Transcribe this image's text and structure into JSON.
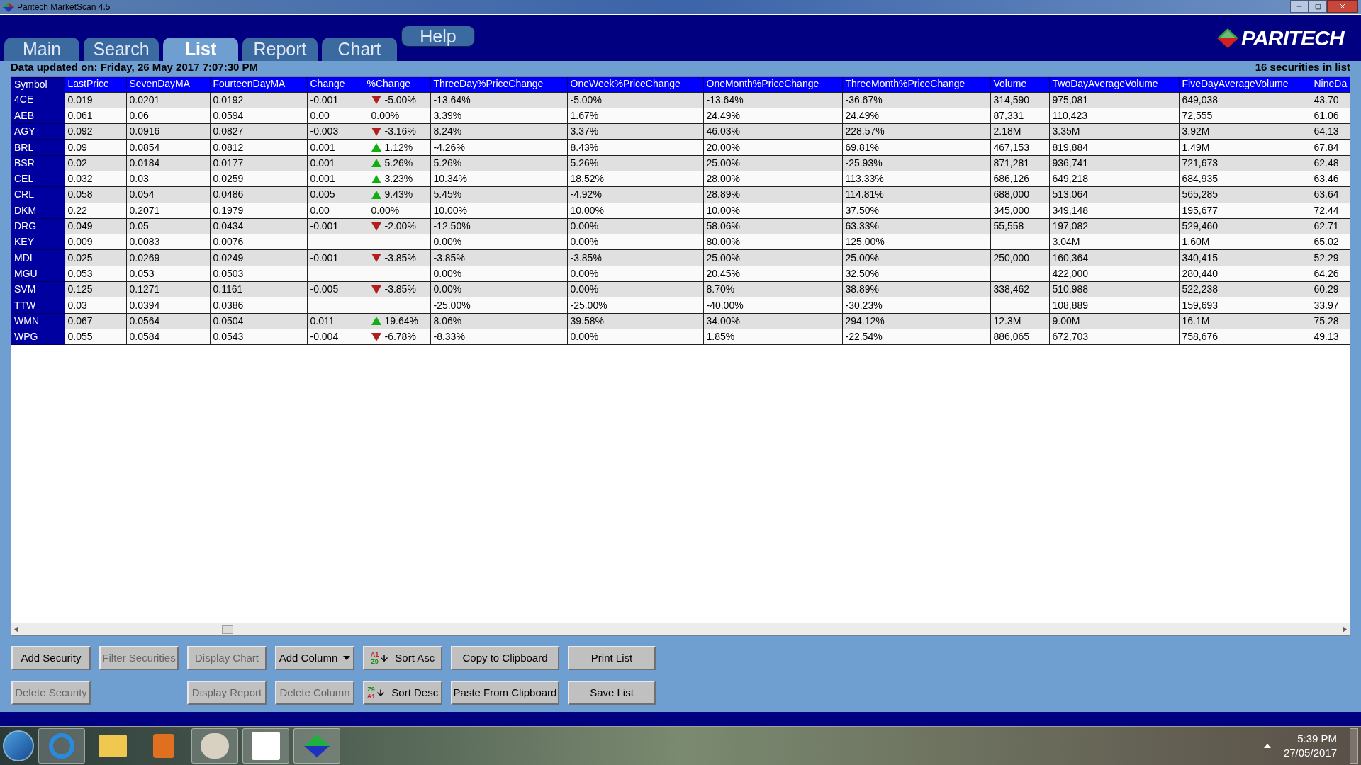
{
  "window": {
    "title": "Paritech MarketScan 4.5"
  },
  "tabs": [
    {
      "label": "Main",
      "kind": "tab",
      "selected": false
    },
    {
      "label": "Search",
      "kind": "tab",
      "selected": false
    },
    {
      "label": "List",
      "kind": "tab",
      "selected": true
    },
    {
      "label": "Report",
      "kind": "tab",
      "selected": false
    },
    {
      "label": "Chart",
      "kind": "tab",
      "selected": false
    },
    {
      "label": "Help",
      "kind": "button",
      "selected": false
    }
  ],
  "logo": {
    "text": "PARITECH"
  },
  "status": {
    "updated": "Data updated on: Friday, 26 May 2017 7:07:30 PM",
    "count": "16 securities in list"
  },
  "table": {
    "columns": [
      "Symbol",
      "LastPrice",
      "SevenDayMA",
      "FourteenDayMA",
      "Change",
      "%Change",
      "ThreeDay%PriceChange",
      "OneWeek%PriceChange",
      "OneMonth%PriceChange",
      "ThreeMonth%PriceChange",
      "Volume",
      "TwoDayAverageVolume",
      "FiveDayAverageVolume",
      "NineDa"
    ],
    "rows": [
      {
        "kind": "down",
        "cells": [
          "4CE",
          "0.019",
          "0.0201",
          "0.0192",
          "-0.001",
          "-5.00%",
          "-13.64%",
          "-5.00%",
          "-13.64%",
          "-36.67%",
          "314,590",
          "975,081",
          "649,038",
          "43.70"
        ]
      },
      {
        "kind": "none",
        "cells": [
          "AEB",
          "0.061",
          "0.06",
          "0.0594",
          "0.00",
          "0.00%",
          "3.39%",
          "1.67%",
          "24.49%",
          "24.49%",
          "87,331",
          "110,423",
          "72,555",
          "61.06"
        ]
      },
      {
        "kind": "down",
        "cells": [
          "AGY",
          "0.092",
          "0.0916",
          "0.0827",
          "-0.003",
          "-3.16%",
          "8.24%",
          "3.37%",
          "46.03%",
          "228.57%",
          "2.18M",
          "3.35M",
          "3.92M",
          "64.13"
        ]
      },
      {
        "kind": "up",
        "cells": [
          "BRL",
          "0.09",
          "0.0854",
          "0.0812",
          "0.001",
          "1.12%",
          "-4.26%",
          "8.43%",
          "20.00%",
          "69.81%",
          "467,153",
          "819,884",
          "1.49M",
          "67.84"
        ]
      },
      {
        "kind": "up",
        "cells": [
          "BSR",
          "0.02",
          "0.0184",
          "0.0177",
          "0.001",
          "5.26%",
          "5.26%",
          "5.26%",
          "25.00%",
          "-25.93%",
          "871,281",
          "936,741",
          "721,673",
          "62.48"
        ]
      },
      {
        "kind": "up",
        "cells": [
          "CEL",
          "0.032",
          "0.03",
          "0.0259",
          "0.001",
          "3.23%",
          "10.34%",
          "18.52%",
          "28.00%",
          "113.33%",
          "686,126",
          "649,218",
          "684,935",
          "63.46"
        ]
      },
      {
        "kind": "up",
        "cells": [
          "CRL",
          "0.058",
          "0.054",
          "0.0486",
          "0.005",
          "9.43%",
          "5.45%",
          "-4.92%",
          "28.89%",
          "114.81%",
          "688,000",
          "513,064",
          "565,285",
          "63.64"
        ]
      },
      {
        "kind": "none",
        "cells": [
          "DKM",
          "0.22",
          "0.2071",
          "0.1979",
          "0.00",
          "0.00%",
          "10.00%",
          "10.00%",
          "10.00%",
          "37.50%",
          "345,000",
          "349,148",
          "195,677",
          "72.44"
        ]
      },
      {
        "kind": "down",
        "cells": [
          "DRG",
          "0.049",
          "0.05",
          "0.0434",
          "-0.001",
          "-2.00%",
          "-12.50%",
          "0.00%",
          "58.06%",
          "63.33%",
          "55,558",
          "197,082",
          "529,460",
          "62.71"
        ]
      },
      {
        "kind": "none",
        "cells": [
          "KEY",
          "0.009",
          "0.0083",
          "0.0076",
          null,
          null,
          "0.00%",
          "0.00%",
          "80.00%",
          "125.00%",
          null,
          "3.04M",
          "1.60M",
          "65.02"
        ]
      },
      {
        "kind": "down",
        "cells": [
          "MDI",
          "0.025",
          "0.0269",
          "0.0249",
          "-0.001",
          "-3.85%",
          "-3.85%",
          "-3.85%",
          "25.00%",
          "25.00%",
          "250,000",
          "160,364",
          "340,415",
          "52.29"
        ]
      },
      {
        "kind": "none",
        "cells": [
          "MGU",
          "0.053",
          "0.053",
          "0.0503",
          null,
          null,
          "0.00%",
          "0.00%",
          "20.45%",
          "32.50%",
          null,
          "422,000",
          "280,440",
          "64.26"
        ]
      },
      {
        "kind": "down",
        "cells": [
          "SVM",
          "0.125",
          "0.1271",
          "0.1161",
          "-0.005",
          "-3.85%",
          "0.00%",
          "0.00%",
          "8.70%",
          "38.89%",
          "338,462",
          "510,988",
          "522,238",
          "60.29"
        ]
      },
      {
        "kind": "none",
        "cells": [
          "TTW",
          "0.03",
          "0.0394",
          "0.0386",
          null,
          null,
          "-25.00%",
          "-25.00%",
          "-40.00%",
          "-30.23%",
          null,
          "108,889",
          "159,693",
          "33.97"
        ]
      },
      {
        "kind": "up",
        "cells": [
          "WMN",
          "0.067",
          "0.0564",
          "0.0504",
          "0.011",
          "19.64%",
          "8.06%",
          "39.58%",
          "34.00%",
          "294.12%",
          "12.3M",
          "9.00M",
          "16.1M",
          "75.28"
        ]
      },
      {
        "kind": "down",
        "cells": [
          "WPG",
          "0.055",
          "0.0584",
          "0.0543",
          "-0.004",
          "-6.78%",
          "-8.33%",
          "0.00%",
          "1.85%",
          "-22.54%",
          "886,065",
          "672,703",
          "758,676",
          "49.13"
        ]
      }
    ]
  },
  "buttons": [
    [
      {
        "label": "Add Security",
        "kind": "plain",
        "disabled": false
      },
      {
        "label": "Filter Securities",
        "kind": "plain",
        "disabled": true
      },
      {
        "label": "Display Chart",
        "kind": "plain",
        "disabled": true
      },
      {
        "label": "Add Column",
        "kind": "dropdown",
        "disabled": false
      },
      {
        "label": "Sort Asc",
        "kind": "sort_asc",
        "icon_top": "A1",
        "icon_bottom": "Z9",
        "disabled": false
      },
      {
        "label": "Copy to Clipboard",
        "kind": "plain",
        "disabled": false
      },
      {
        "label": "Print List",
        "kind": "plain",
        "disabled": false
      }
    ],
    [
      {
        "label": "Delete Security",
        "kind": "plain",
        "disabled": true
      },
      {
        "label": "Display Report",
        "kind": "plain",
        "disabled": true
      },
      {
        "label": "Delete Column",
        "kind": "plain",
        "disabled": true
      },
      {
        "label": "Sort Desc",
        "kind": "sort_desc",
        "icon_top": "Z9",
        "icon_bottom": "A1",
        "disabled": false
      },
      {
        "label": "Paste From Clipboard",
        "kind": "plain",
        "disabled": false
      },
      {
        "label": "Save List",
        "kind": "plain",
        "disabled": false
      }
    ]
  ],
  "taskbar": {
    "time": "5:39 PM",
    "date": "27/05/2017"
  }
}
